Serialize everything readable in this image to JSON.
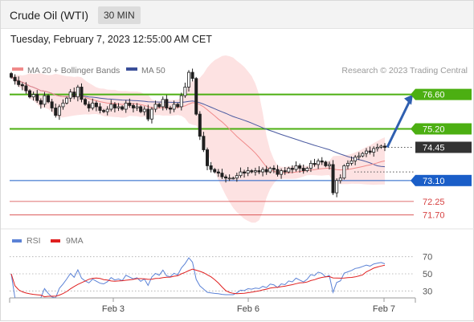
{
  "header": {
    "title": "Crude Oil (WTI)",
    "timeframe": "30 MIN"
  },
  "date_line": "Tuesday, February 7, 2023 12:55:00 AM CET",
  "legend": {
    "ma_bb": "MA 20 + Bollinger Bands",
    "ma50": "MA 50",
    "credit": "Research © 2023 Trading Central",
    "rsi": "RSI",
    "ma9": "9MA"
  },
  "colors": {
    "green": "#4caf12",
    "blue": "#1a5ec8",
    "red": "#d64040",
    "bb_fill": "#fde2e2",
    "ma20": "#f08a8a",
    "ma50": "#4a5aa0",
    "candle": "#1f1f1f",
    "rsi_line": "#5b82d6",
    "ma9_line": "#e02020",
    "arrow": "#2f5fb0",
    "current": "#333333"
  },
  "chart_data": [
    {
      "type": "candlestick",
      "title": "Crude Oil (WTI)",
      "timeframe": "30 MIN",
      "x_ticks": [
        "Feb 3",
        "Feb 6",
        "Feb 7"
      ],
      "ylim": [
        71.2,
        77.6
      ],
      "series": [
        {
          "name": "MA 20 + Bollinger Bands"
        },
        {
          "name": "MA 50"
        }
      ],
      "levels": [
        {
          "label": "76.60",
          "value": 76.6,
          "kind": "resistance"
        },
        {
          "label": "75.20",
          "value": 75.2,
          "kind": "resistance"
        },
        {
          "label": "74.45",
          "value": 74.45,
          "kind": "current"
        },
        {
          "label": "73.10",
          "value": 73.1,
          "kind": "support"
        },
        {
          "label": "72.25",
          "value": 72.25,
          "kind": "support"
        },
        {
          "label": "71.70",
          "value": 71.7,
          "kind": "support"
        }
      ],
      "arrow": {
        "from": 74.45,
        "to": 76.6
      },
      "close": [
        77.3,
        77.15,
        77.0,
        76.95,
        76.75,
        76.5,
        76.6,
        76.35,
        76.2,
        76.55,
        76.3,
        76.05,
        75.75,
        76.1,
        76.25,
        76.45,
        76.7,
        76.5,
        76.9,
        76.4,
        76.2,
        76.05,
        76.25,
        76.1,
        75.95,
        75.9,
        76.0,
        76.2,
        76.05,
        76.1,
        76.0,
        76.25,
        76.15,
        76.05,
        76.1,
        75.9,
        76.0,
        75.6,
        76.0,
        76.2,
        76.1,
        76.4,
        76.05,
        76.0,
        76.2,
        76.1,
        76.55,
        76.9,
        77.5,
        77.25,
        75.8,
        74.9,
        74.35,
        73.7,
        73.55,
        73.45,
        73.4,
        73.25,
        73.2,
        73.2,
        73.2,
        73.3,
        73.45,
        73.4,
        73.5,
        73.45,
        73.5,
        73.45,
        73.55,
        73.45,
        73.6,
        73.55,
        73.35,
        73.5,
        73.45,
        73.6,
        73.55,
        73.7,
        73.6,
        73.5,
        73.6,
        73.8,
        73.75,
        73.9,
        73.85,
        73.7,
        73.75,
        72.6,
        73.1,
        73.2,
        73.7,
        73.8,
        73.9,
        74.05,
        74.1,
        74.2,
        74.3,
        74.25,
        74.4,
        74.45,
        74.5,
        74.45
      ],
      "rsi": {
        "levels": [
          70,
          50,
          30
        ],
        "ylim": [
          20,
          80
        ]
      }
    }
  ]
}
